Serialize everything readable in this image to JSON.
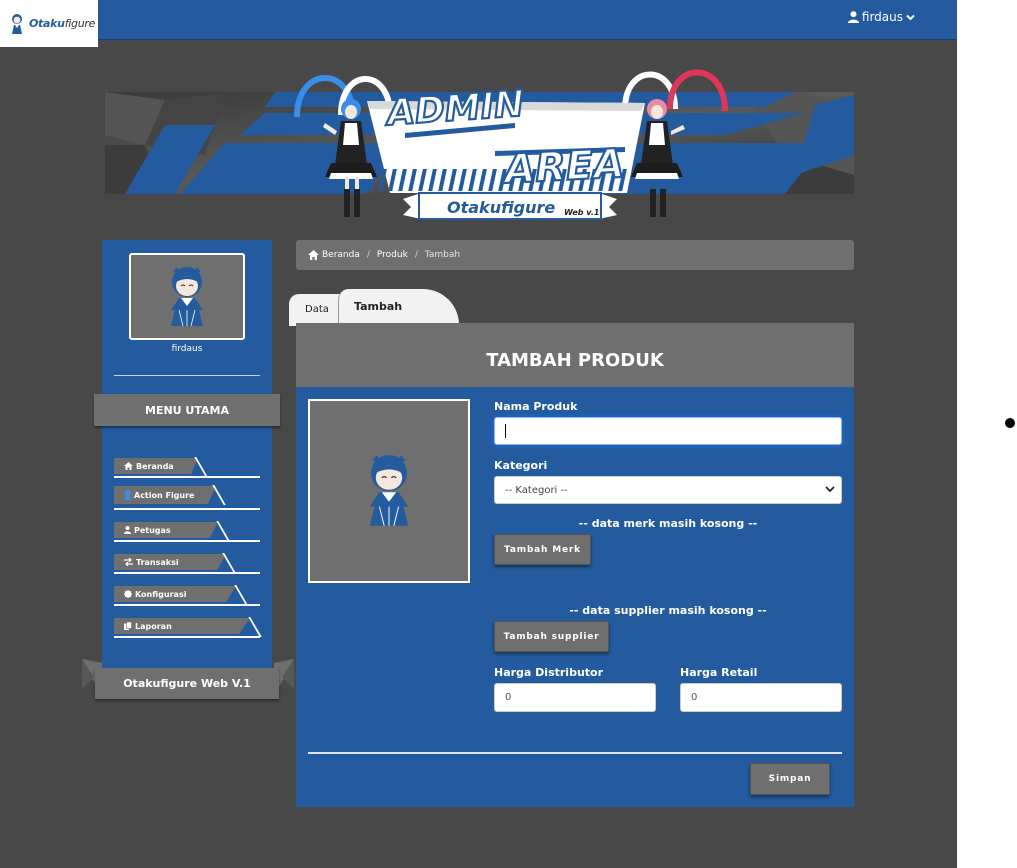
{
  "brand": {
    "name": "Otakufigure",
    "name_prefix": "Otaku",
    "name_suffix": "figure"
  },
  "user_menu": {
    "username": "firdaus",
    "icon": "user-icon",
    "chevron": "chevron-down-icon"
  },
  "banner": {
    "title_line1": "ADMIN",
    "title_line2": "AREA",
    "ribbon_text": "Otakufigure",
    "ribbon_version": "Web v.1"
  },
  "sidebar": {
    "username": "firdaus",
    "menu_title": "MENU UTAMA",
    "items": [
      {
        "label": "Beranda",
        "icon": "home-icon"
      },
      {
        "label": "Action Figure",
        "icon": "figure-icon"
      },
      {
        "label": "Petugas",
        "icon": "user-icon"
      },
      {
        "label": "Transaksi",
        "icon": "exchange-icon"
      },
      {
        "label": "Konfigurasi",
        "icon": "gear-icon"
      },
      {
        "label": "Laporan",
        "icon": "copy-icon"
      }
    ],
    "footer": "Otakufigure Web V.1"
  },
  "breadcrumb": [
    "Beranda",
    "Produk",
    "Tambah"
  ],
  "tabs": {
    "data": "Data",
    "tambah": "Tambah"
  },
  "form": {
    "title": "TAMBAH PRODUK",
    "nama_label": "Nama Produk",
    "nama_value": "",
    "kategori_label": "Kategori",
    "kategori_selected": "-- Kategori --",
    "merk_empty_note": "-- data merk masih kosong --",
    "merk_button": "Tambah Merk",
    "supplier_empty_note": "-- data supplier masih kosong --",
    "supplier_button": "Tambah supplier",
    "harga_distributor_label": "Harga Distributor",
    "harga_distributor_value": "0",
    "harga_retail_label": "Harga Retail",
    "harga_retail_value": "0",
    "submit_button": "Simpan"
  },
  "colors": {
    "primary": "#235b9e",
    "panel_grey": "#6f6f6f",
    "page_bg": "#484848"
  }
}
